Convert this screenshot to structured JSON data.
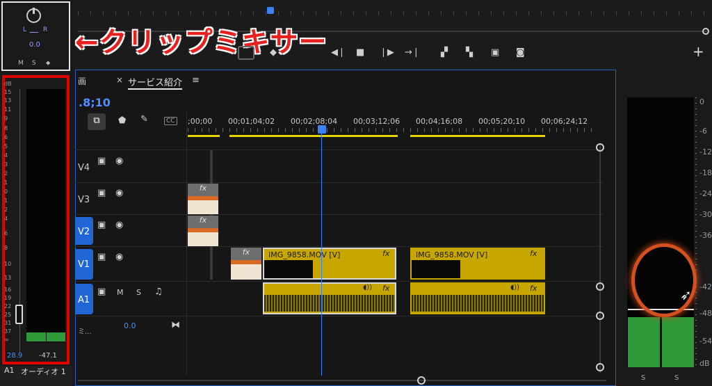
{
  "annotation": {
    "label": "←クリップミキサー"
  },
  "mixer": {
    "pan_left": "L",
    "pan_right": "R",
    "pan_value": "0.0",
    "mute": "M",
    "solo": "S",
    "scale_unit": "dB",
    "scale": [
      "15",
      "13",
      "11",
      "9",
      "8",
      "6",
      "5",
      "4",
      "3",
      "2",
      "1",
      "0",
      "-1",
      "-2",
      "-4",
      "-6",
      "-8",
      "-10",
      "-13",
      "-16",
      "-19",
      "-22",
      "-25",
      "-31",
      "-37",
      "-∞"
    ],
    "scale_visible": [
      "dB",
      "15",
      "13",
      "11",
      "9",
      "8",
      "6",
      "5",
      "4",
      "3",
      "2",
      "1",
      "0",
      "1",
      "2",
      "4",
      "6",
      "8",
      "10",
      "13",
      "16",
      "19",
      "22",
      "25",
      "31",
      "37",
      "∞"
    ],
    "peak_left": "28.9",
    "peak_right": "-47.1",
    "channel": "A1",
    "channel_label": "オーディオ 1"
  },
  "timeline": {
    "panel_stub": "画",
    "close": "×",
    "sequence_name": "サービス紹介",
    "menu": "≡",
    "timecode": ".8;10",
    "cc": "CC",
    "ruler": [
      ";00;00",
      "00;01;04;02",
      "00;02;08;04",
      "00;03;12;06",
      "00;04;16;08",
      "00;05;20;10",
      "00;06;24;12"
    ],
    "tracks": {
      "v4": "V4",
      "v3": "V3",
      "v2": "V2",
      "v1": "V1",
      "a1": "A1",
      "a1_mute": "M",
      "a1_solo": "S",
      "master_value": "0.0",
      "master_label": "ミ..."
    },
    "clips": {
      "v1_clip1": "IMG_9858.MOV [V]",
      "v1_clip2": "IMG_9858.MOV [V]",
      "fx": "fx"
    }
  },
  "transport": {
    "add": "+"
  },
  "right_meter": {
    "scale": [
      "0",
      "-6",
      "-12",
      "-18",
      "-24",
      "-30",
      "-36",
      "-42",
      "-48",
      "-54",
      "dB"
    ],
    "solo_left": "S",
    "solo_right": "S"
  },
  "colors": {
    "accent_red": "#e00000",
    "playhead": "#3b82f6",
    "clip": "#c8a600",
    "meter_green": "#2f9a3a",
    "highlight_circle": "#d4501e"
  }
}
